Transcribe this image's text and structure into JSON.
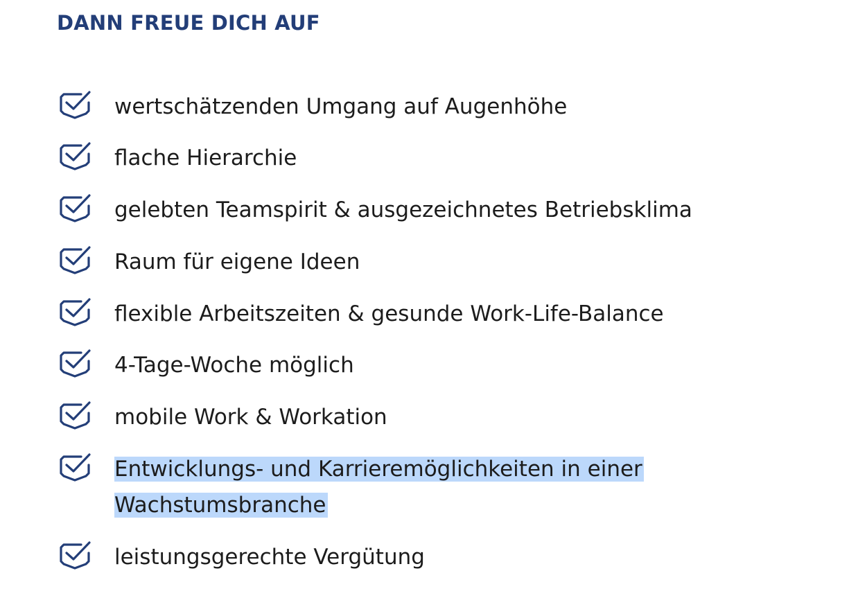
{
  "heading": "DANN FREUE DICH AUF",
  "accent_color": "#233e78",
  "selection_color": "#bcd8fb",
  "icon": "checkbox-check-icon",
  "benefits": [
    {
      "text": "wertschätzenden Umgang auf Augenhöhe"
    },
    {
      "text": "flache Hierarchie"
    },
    {
      "text": "gelebten Teamspirit & ausgezeichnetes Betriebsklima"
    },
    {
      "text": "Raum für eigene Ideen"
    },
    {
      "text": "flexible Arbeitszeiten & gesunde Work-Life-Balance"
    },
    {
      "text": "4-Tage-Woche möglich"
    },
    {
      "text": "mobile Work & Workation"
    },
    {
      "text": "Entwicklungs- und Karrieremöglichkeiten in einer Wachstumsbranche",
      "selected": true
    },
    {
      "text": "leistungsgerechte Vergütung"
    }
  ]
}
